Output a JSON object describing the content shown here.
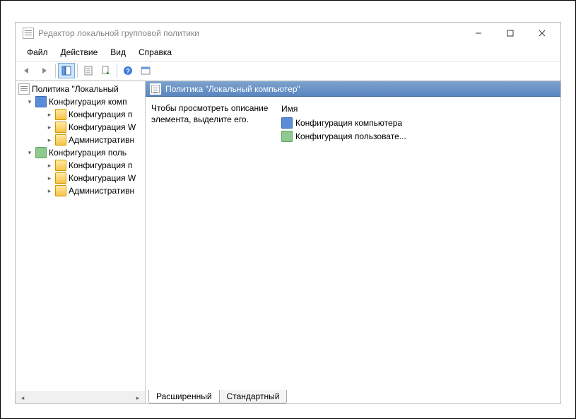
{
  "window": {
    "title": "Редактор локальной групповой политики"
  },
  "menubar": {
    "file": "Файл",
    "action": "Действие",
    "view": "Вид",
    "help": "Справка"
  },
  "tree": {
    "root": "Политика \"Локальный ",
    "computer": "Конфигурация комп",
    "computer_children": [
      "Конфигурация п",
      "Конфигурация W",
      "Административн"
    ],
    "user": "Конфигурация поль",
    "user_children": [
      "Конфигурация п",
      "Конфигурация W",
      "Административн"
    ]
  },
  "main": {
    "header": "Политика \"Локальный компьютер\"",
    "description": "Чтобы просмотреть описание элемента, выделите его.",
    "column_name": "Имя",
    "items": [
      "Конфигурация компьютера",
      "Конфигурация пользовате..."
    ]
  },
  "tabs": {
    "extended": "Расширенный",
    "standard": "Стандартный"
  }
}
